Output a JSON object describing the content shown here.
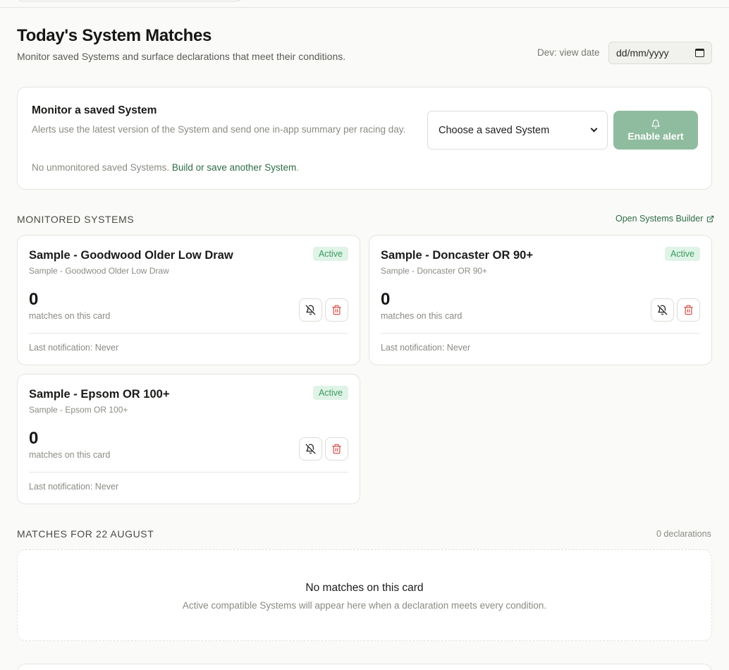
{
  "header": {
    "title": "Today's System Matches",
    "subtitle": "Monitor saved Systems and surface declarations that meet their conditions.",
    "dev_date_label": "Dev: view date",
    "date_placeholder": "dd/mm/yyyy"
  },
  "monitor": {
    "title": "Monitor a saved System",
    "description": "Alerts use the latest version of the System and send one in-app summary per racing day.",
    "no_unmonitored": "No unmonitored saved Systems.",
    "build_link": "Build or save another System",
    "build_link_suffix": ".",
    "select_value": "Choose a saved System",
    "enable_button": "Enable alert"
  },
  "monitored": {
    "section_label": "MONITORED SYSTEMS",
    "builder_link": "Open Systems Builder",
    "cards": [
      {
        "name": "Sample - Goodwood Older Low Draw",
        "subtitle": "Sample - Goodwood Older Low Draw",
        "status": "Active",
        "count": "0",
        "count_label": "matches on this card",
        "last_notification": "Last notification: Never"
      },
      {
        "name": "Sample - Doncaster OR 90+",
        "subtitle": "Sample - Doncaster OR 90+",
        "status": "Active",
        "count": "0",
        "count_label": "matches on this card",
        "last_notification": "Last notification: Never"
      },
      {
        "name": "Sample - Epsom OR 100+",
        "subtitle": "Sample - Epsom OR 100+",
        "status": "Active",
        "count": "0",
        "count_label": "matches on this card",
        "last_notification": "Last notification: Never"
      }
    ]
  },
  "matches": {
    "section_label": "MATCHES FOR 22 AUGUST",
    "declarations": "0 declarations",
    "empty_title": "No matches on this card",
    "empty_desc": "Active compatible Systems will appear here when a declaration meets every condition."
  },
  "icons": {
    "mute": "bell-off-icon",
    "delete": "trash-icon",
    "external": "external-link-icon",
    "bell": "bell-icon",
    "calendar": "calendar-icon",
    "chevron": "chevron-down-icon"
  },
  "colors": {
    "accent_green": "#2f6b46",
    "button_green": "#8fbc9f",
    "badge_bg": "#dff3e6",
    "badge_text": "#3d9a63",
    "delete_red": "#d9534f"
  }
}
